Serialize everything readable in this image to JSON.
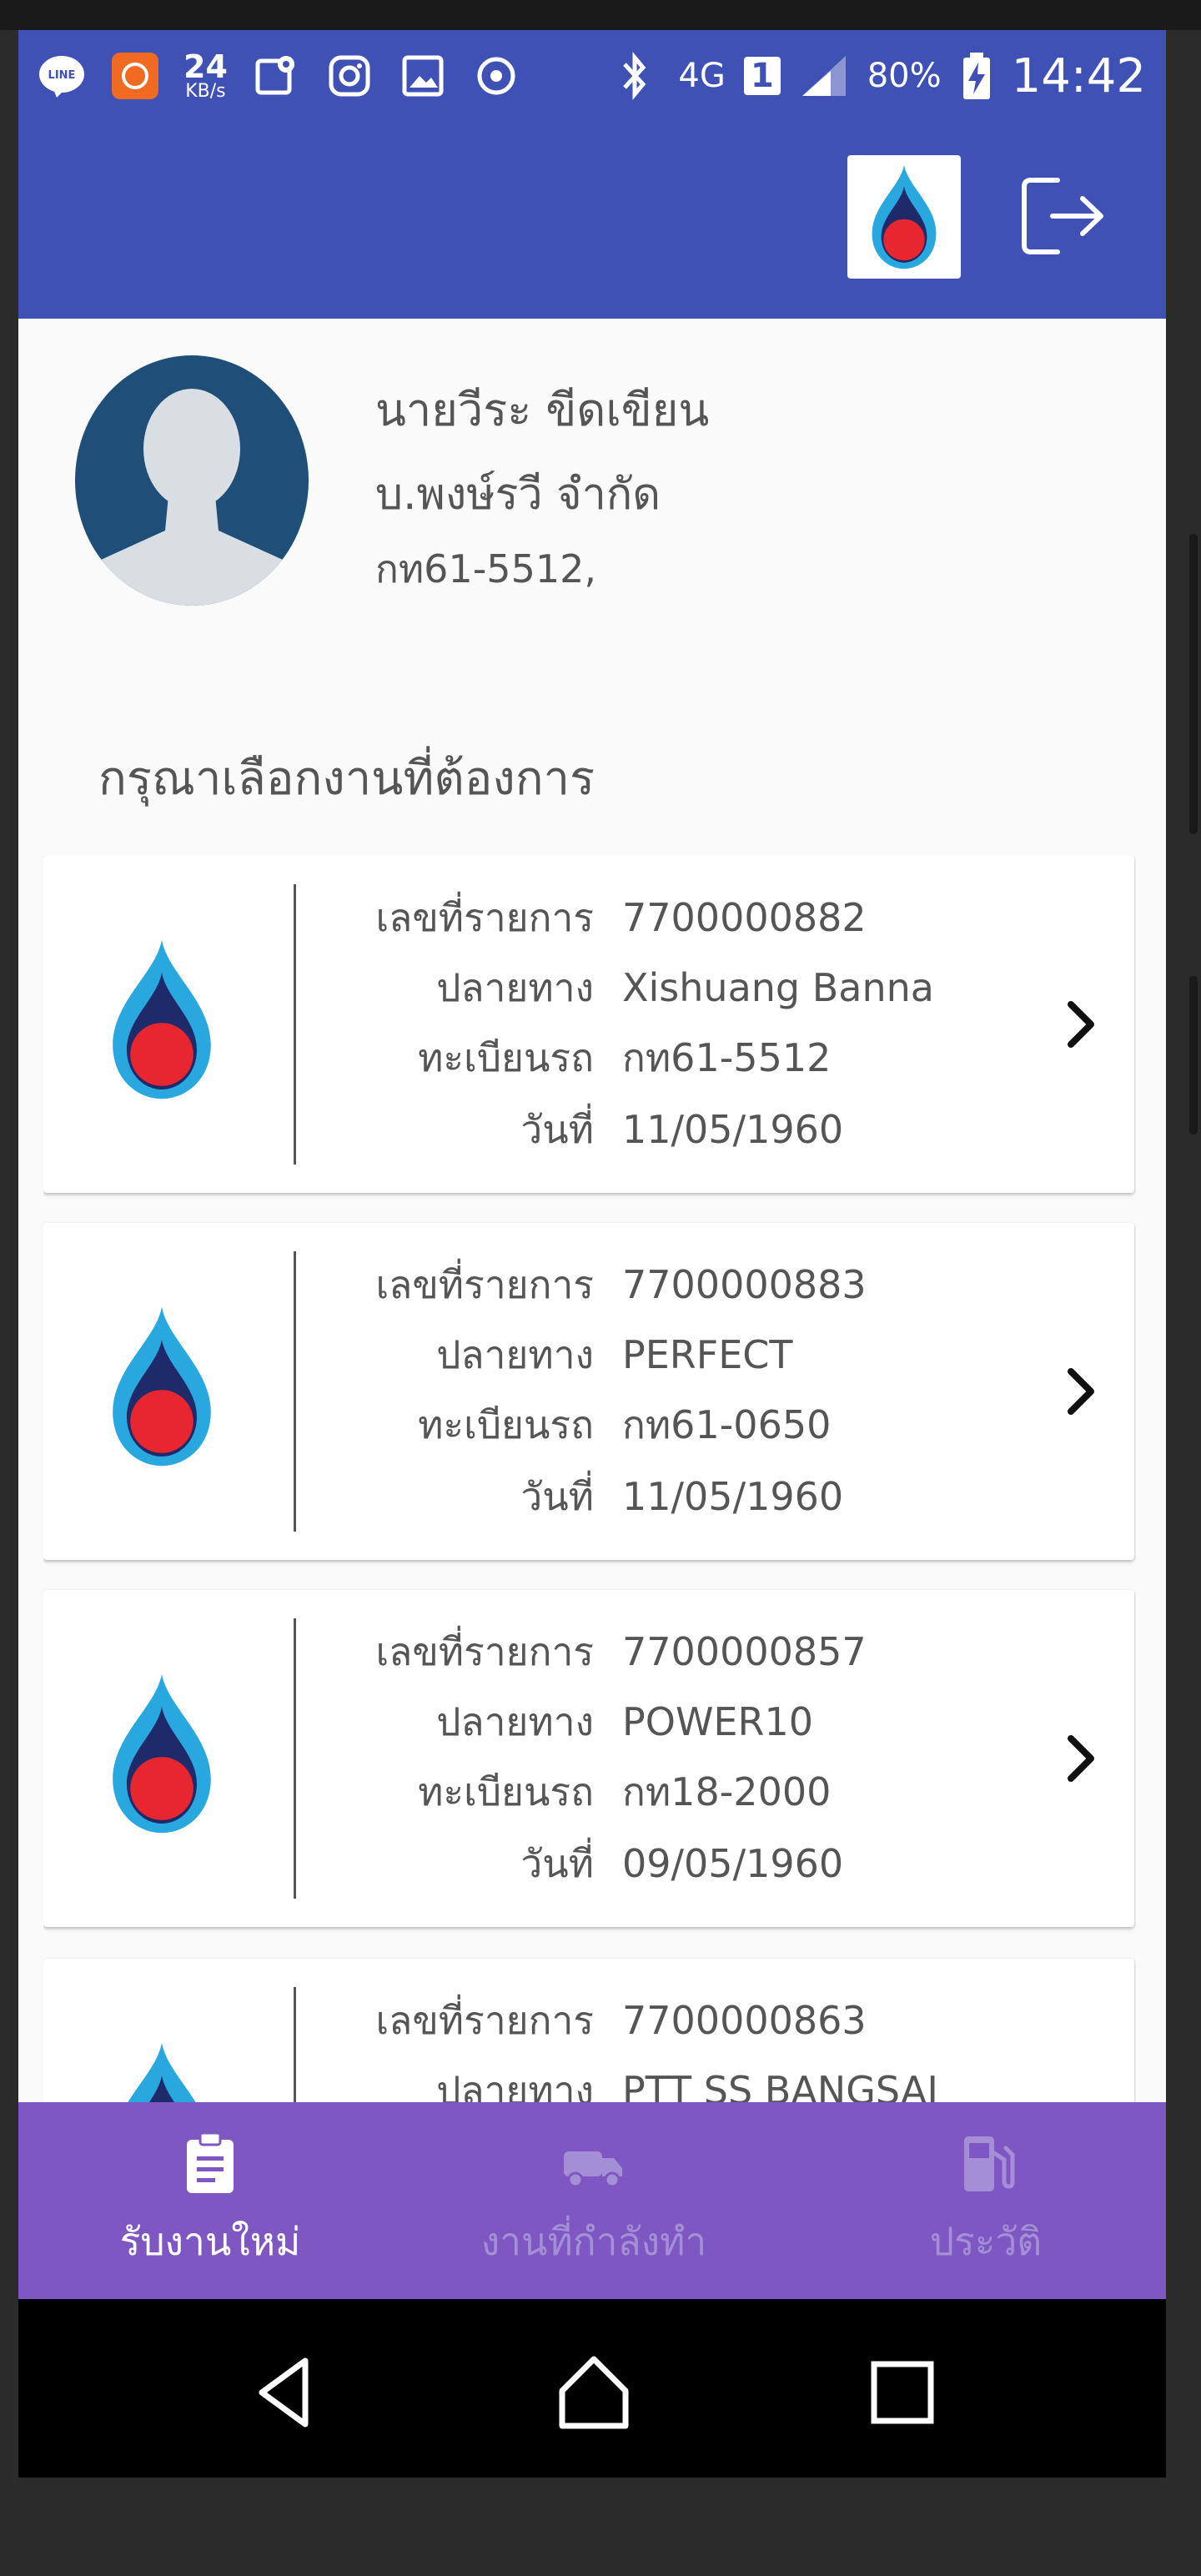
{
  "status_bar": {
    "icons": [
      "line-icon",
      "mi-icon",
      "maps-icon",
      "instagram-icon",
      "gallery-icon",
      "sync-icon",
      "bluetooth-icon"
    ],
    "speed_value": "24",
    "speed_unit": "KB/s",
    "network": "4G",
    "sim": "1",
    "battery": "80%",
    "time": "14:42"
  },
  "app_bar": {
    "logo_icon": "ptt-flame-logo",
    "logout_icon": "logout-icon"
  },
  "profile": {
    "name": "นายวีระ  ขีดเขียน",
    "company": "บ.พงษ์รวี จำกัด",
    "plate": "กท61-5512,"
  },
  "prompt": "กรุณาเลือกงานที่ต้องการ",
  "labels": {
    "job_no": "เลขที่รายการ",
    "destination": "ปลายทาง",
    "plate": "ทะเบียนรถ",
    "date": "วันที่"
  },
  "jobs": [
    {
      "job_no": "7700000882",
      "destination": "Xishuang Banna",
      "plate": "กท61-5512",
      "date": "11/05/1960"
    },
    {
      "job_no": "7700000883",
      "destination": "PERFECT",
      "plate": "กท61-0650",
      "date": "11/05/1960"
    },
    {
      "job_no": "7700000857",
      "destination": "POWER10",
      "plate": "กท18-2000",
      "date": "09/05/1960"
    },
    {
      "job_no": "7700000863",
      "destination": "PTT SS BANGSAI",
      "plate": "",
      "date": ""
    }
  ],
  "bottom_nav": {
    "tabs": [
      {
        "label": "รับงานใหม่",
        "icon": "clipboard-icon",
        "active": true
      },
      {
        "label": "งานที่กำลังทำ",
        "icon": "truck-icon",
        "active": false
      },
      {
        "label": "ประวัติ",
        "icon": "fuel-pump-icon",
        "active": false
      }
    ]
  },
  "colors": {
    "primary": "#3f51b5",
    "bottom_nav": "#7e57c2",
    "flame_blue": "#29a8e0",
    "flame_navy": "#1f2a6b",
    "flame_red": "#e8262f"
  }
}
